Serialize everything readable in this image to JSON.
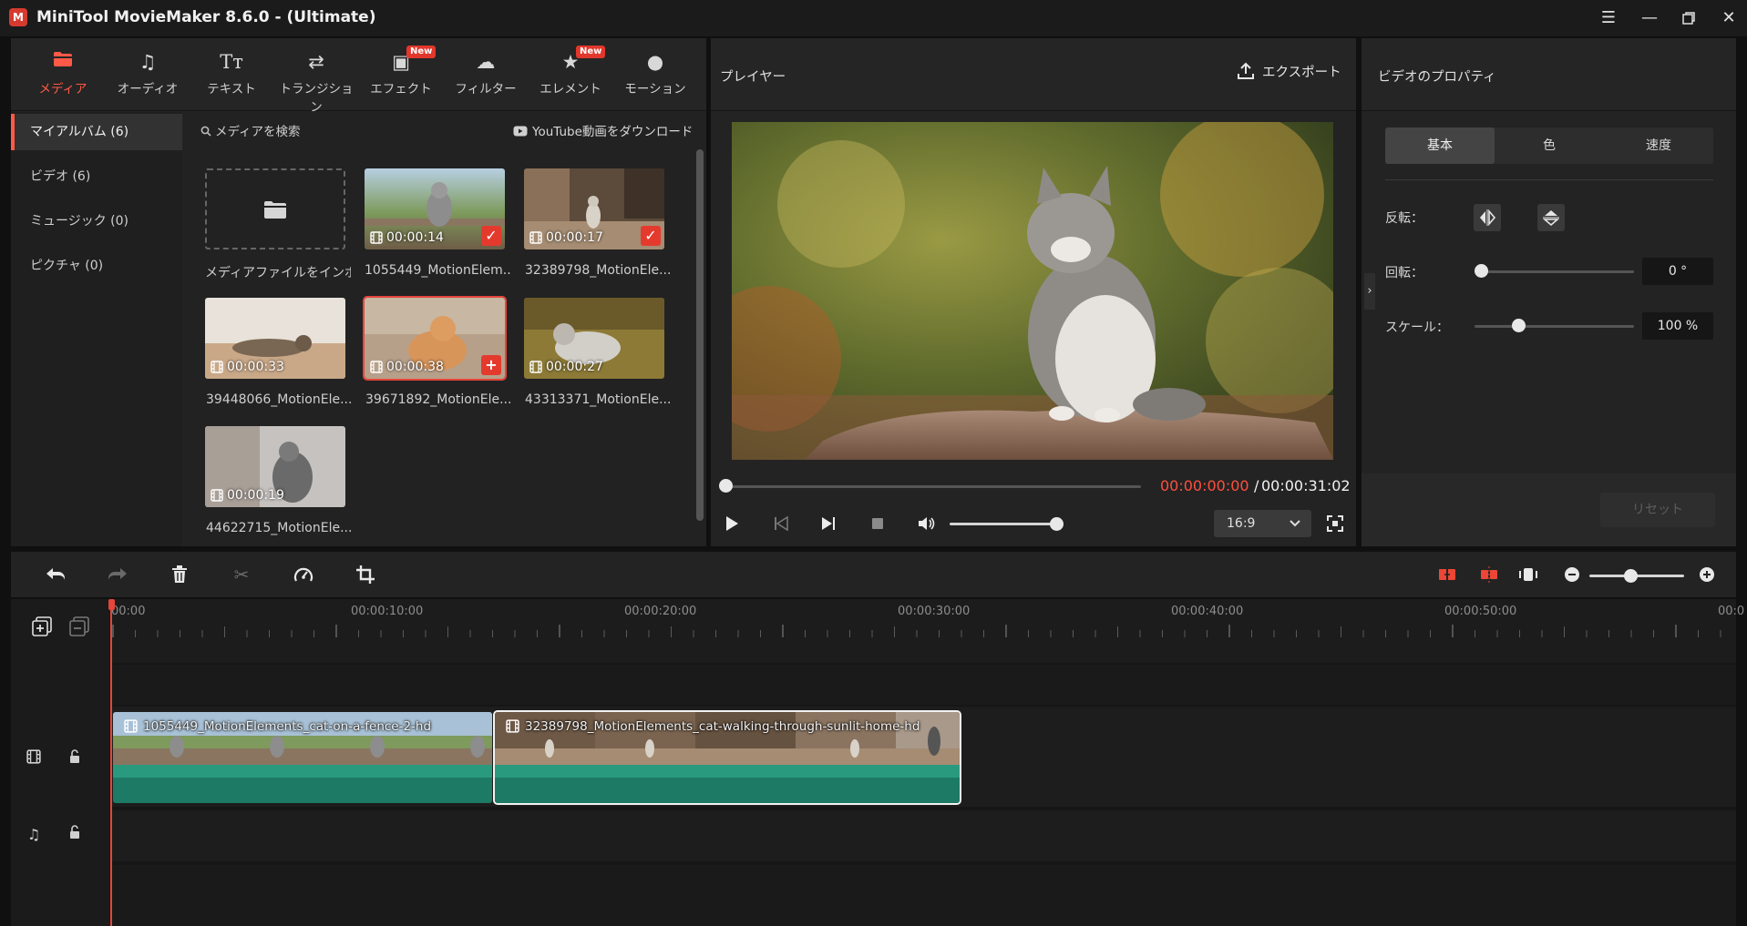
{
  "window": {
    "title": "MiniTool MovieMaker 8.6.0 - (Ultimate)",
    "logo_text": "M"
  },
  "toolbar": {
    "tabs": [
      {
        "label": "メディア",
        "icon": "folder-icon",
        "active": true
      },
      {
        "label": "オーディオ",
        "icon": "music-note-icon"
      },
      {
        "label": "テキスト",
        "icon": "text-icon"
      },
      {
        "label": "トランジション",
        "icon": "swap-arrows-icon"
      },
      {
        "label": "エフェクト",
        "icon": "effects-icon",
        "badge": "New"
      },
      {
        "label": "フィルター",
        "icon": "filter-icon"
      },
      {
        "label": "エレメント",
        "icon": "elements-icon",
        "badge": "New"
      },
      {
        "label": "モーション",
        "icon": "motion-icon"
      }
    ]
  },
  "sidebar": {
    "items": [
      {
        "label": "マイアルバム (6)",
        "active": true
      },
      {
        "label": "ビデオ (6)"
      },
      {
        "label": "ミュージック (0)"
      },
      {
        "label": "ピクチャ (0)"
      }
    ]
  },
  "media": {
    "search_placeholder": "メディアを検索",
    "youtube_label": "YouTube動画をダウンロード",
    "import_label": "メディアファイルをインポート",
    "items": [
      {
        "name": "1055449_MotionElem...",
        "duration": "00:00:14",
        "badge": "check"
      },
      {
        "name": "32389798_MotionEle...",
        "duration": "00:00:17",
        "badge": "check"
      },
      {
        "name": "39448066_MotionEle...",
        "duration": "00:00:33"
      },
      {
        "name": "39671892_MotionEle...",
        "duration": "00:00:38",
        "badge": "plus",
        "selected": true
      },
      {
        "name": "43313371_MotionEle...",
        "duration": "00:00:27"
      },
      {
        "name": "44622715_MotionEle...",
        "duration": "00:00:19"
      }
    ]
  },
  "player": {
    "title": "プレイヤー",
    "export_label": "エクスポート",
    "time_current": "00:00:00:00",
    "time_separator": "/",
    "time_total": "00:00:31:02",
    "aspect": "16:9",
    "progress": 0,
    "volume": 0.8
  },
  "properties": {
    "title": "ビデオのプロパティ",
    "tabs": [
      "基本",
      "色",
      "速度"
    ],
    "flip_label": "反転：",
    "rotate_label": "回転：",
    "rotate_value": "0 °",
    "rotate_level": 0,
    "scale_label": "スケール：",
    "scale_value": "100 %",
    "scale_level": 0.27,
    "reset_label": "リセット"
  },
  "timeline": {
    "ruler_labels": [
      "00:00",
      "00:00:10:00",
      "00:00:20:00",
      "00:00:30:00",
      "00:00:40:00",
      "00:00:50:00",
      "00:0"
    ],
    "zoom_level": 0.37,
    "clips": [
      {
        "title": "1055449_MotionElements_cat-on-a-fence-2-hd"
      },
      {
        "title": "32389798_MotionElements_cat-walking-through-sunlit-home-hd",
        "selected": true
      }
    ]
  },
  "colors": {
    "accent": "#ff5a48",
    "clip_green": "#2a9a7e",
    "playhead": "#e5453b"
  }
}
